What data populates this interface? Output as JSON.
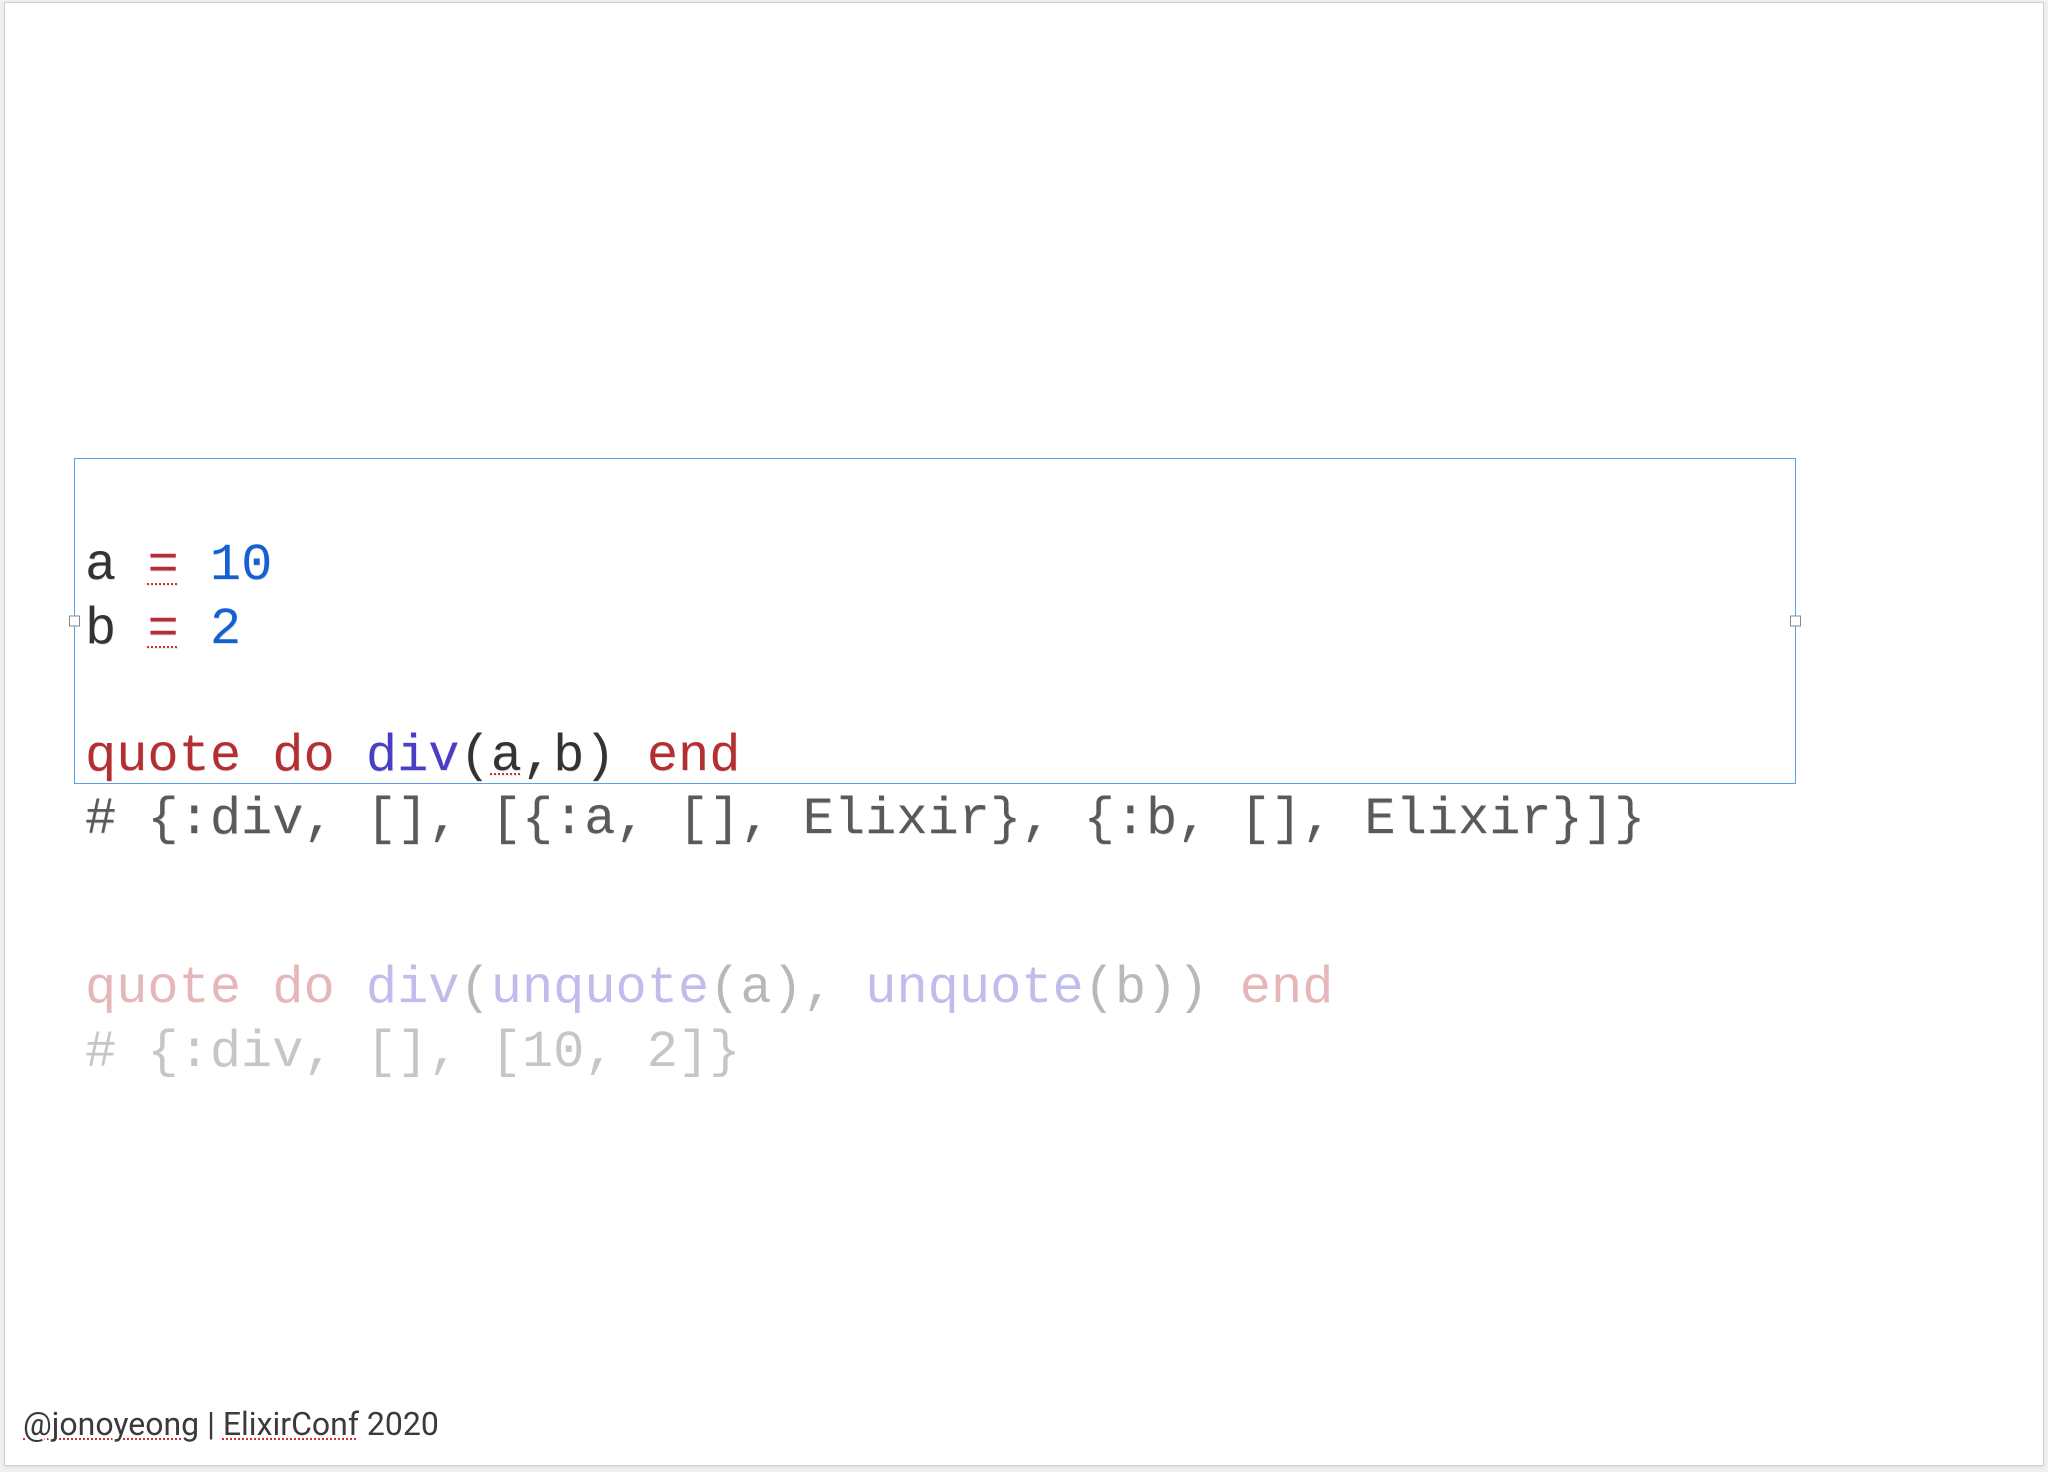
{
  "block1": {
    "line1": {
      "var": "a",
      "op": "=",
      "num": "10"
    },
    "line2": {
      "var": "b",
      "op": "=",
      "num": "2"
    },
    "line3": {
      "kw1": "quote",
      "kw2": "do",
      "fn": "div",
      "args_open": "(",
      "arg_a": "a",
      "comma": ",",
      "arg_b": "b",
      "args_close": ")",
      "kw3": "end"
    },
    "line4": {
      "comment": "# {:div, [], [{:a, [], Elixir}, {:b, [], Elixir}]}"
    }
  },
  "block2": {
    "line1": {
      "kw1": "quote",
      "kw2": "do",
      "fn": "div",
      "open": "(",
      "uq1": "unquote",
      "po1": "(",
      "a": "a",
      "pc1": ")",
      "comma": ", ",
      "uq2": "unquote",
      "po2": "(",
      "b": "b",
      "pc2": ")",
      "close": ")",
      "kw3": "end"
    },
    "line2": {
      "comment": "# {:div, [], [10, 2]}"
    }
  },
  "footer": {
    "handle": "@jonoyeong",
    "sep": " | ",
    "conf": "ElixirConf",
    "year": " 2020"
  }
}
